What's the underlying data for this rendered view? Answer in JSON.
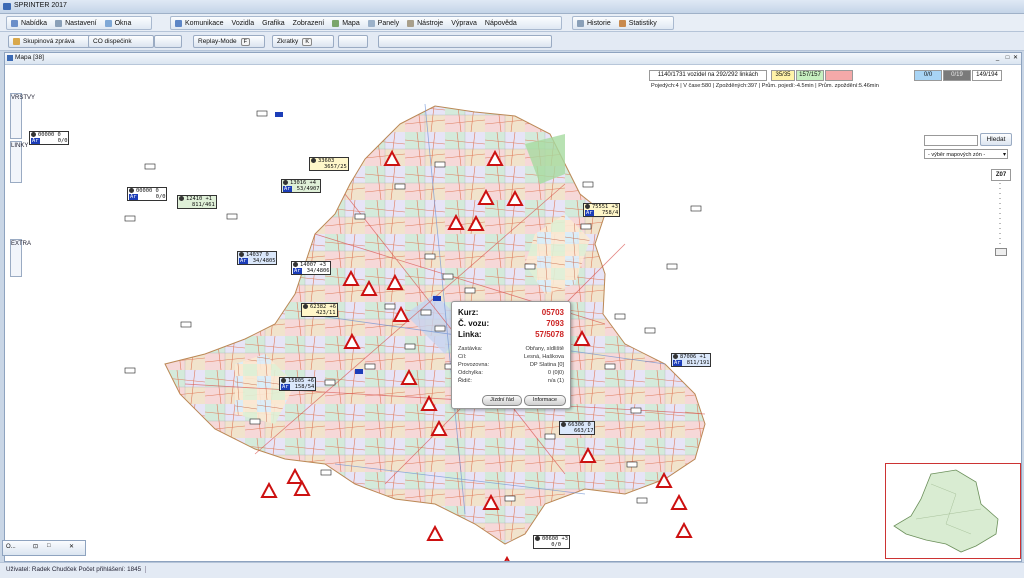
{
  "app": {
    "title": "SPRINTER 2017"
  },
  "menu": {
    "group1": [
      "Nabídka",
      "Nastavení",
      "Okna"
    ],
    "group2": [
      "Komunikace",
      "Vozidla",
      "Grafika",
      "Zobrazení",
      "Mapa",
      "Panely",
      "Nástroje",
      "Výprava",
      "Nápověda"
    ],
    "group3": [
      "Historie",
      "Statistiky"
    ]
  },
  "toolbar": {
    "group_message": "Skupinová zpráva",
    "dispatcher": "CO dispečink",
    "replay_mode": "Replay-Mode",
    "replay_key": "F",
    "shortcuts": "Zkratky",
    "shortcuts_key": "K"
  },
  "map_window": {
    "title": "Mapa [38]"
  },
  "side_tabs": {
    "layers": "VRSTVY",
    "lines": "LINKY",
    "extra": "EXTRA"
  },
  "status": {
    "vehicles": "1140/1731 vozidel na 292/292 linkách",
    "b1": "35/35",
    "b2": "157/157",
    "b3": "",
    "b4": "0/0",
    "b5": "0/19",
    "b6": "149/194",
    "b1_color": "#fff3a8",
    "b2_color": "#c7efc0",
    "b3_color": "#f4a9a9",
    "b4_color": "#a8d4f5",
    "b5_color": "#7a7a7a",
    "line2": "Pojedých:4 | V čase:580 | Zpožděných:397 | Prům. pojedí:-4.5min | Prům. zpoždění:5.46min"
  },
  "search": {
    "button": "Hledat",
    "zone_select": "- výběr mapových zón -"
  },
  "zoom": {
    "label": "Z07",
    "level": 0.1
  },
  "popup": {
    "kurz_label": "Kurz:",
    "kurz": "05703",
    "vuz_label": "Č. vozu:",
    "vuz": "7093",
    "linka_label": "Linka:",
    "linka": "57/5078",
    "rows": [
      {
        "label": "Zastávka:",
        "value": "Obřany, sídliště"
      },
      {
        "label": "Cíl:",
        "value": "Lesná, Haškova"
      },
      {
        "label": "Provozovna:",
        "value": "DP Slatina [0]"
      },
      {
        "label": "Odchylka:",
        "value": "0 (0|0)"
      },
      {
        "label": "Řidič:",
        "value": "n/a (1)"
      }
    ],
    "btn_route": "Jízdní řád",
    "btn_info": "Informace"
  },
  "vehicles": [
    {
      "num": "00000",
      "delay": "0",
      "line": "0/0",
      "tag": "Ar",
      "style": ""
    },
    {
      "num": "00000",
      "delay": "0",
      "line": "0/0",
      "tag": "Ar",
      "style": ""
    },
    {
      "num": "12410",
      "delay": "+1",
      "line": "811/461",
      "tag": "",
      "style": "g"
    },
    {
      "num": "33603",
      "delay": "",
      "line": "3657/25",
      "tag": "",
      "style": "y"
    },
    {
      "num": "13016",
      "delay": "+4",
      "line": "53/4907",
      "tag": "Ar",
      "style": "g"
    },
    {
      "num": "14037",
      "delay": "0",
      "line": "34/4805",
      "tag": "Ar",
      "style": "b"
    },
    {
      "num": "14007",
      "delay": "+3",
      "line": "34/4806",
      "tag": "Ar",
      "style": ""
    },
    {
      "num": "62382",
      "delay": "+6",
      "line": "423/11",
      "tag": "",
      "style": "y"
    },
    {
      "num": "75551",
      "delay": "+3",
      "line": "758/4",
      "tag": "Ar",
      "style": "y"
    },
    {
      "num": "87006",
      "delay": "+1",
      "line": "811/191",
      "tag": "Ar",
      "style": "b"
    },
    {
      "num": "15805",
      "delay": "+6",
      "line": "158/54",
      "tag": "Ar",
      "style": "b"
    },
    {
      "num": "66306",
      "delay": "0",
      "line": "663/17",
      "tag": "",
      "style": "b"
    },
    {
      "num": "00600",
      "delay": "+3",
      "line": "0/0",
      "tag": "",
      "style": ""
    }
  ],
  "bottom_panel": {
    "label": "O..."
  },
  "statusbar": {
    "text": "Uživatel: Radek Chudček  Počet přihlášení: 1845"
  }
}
